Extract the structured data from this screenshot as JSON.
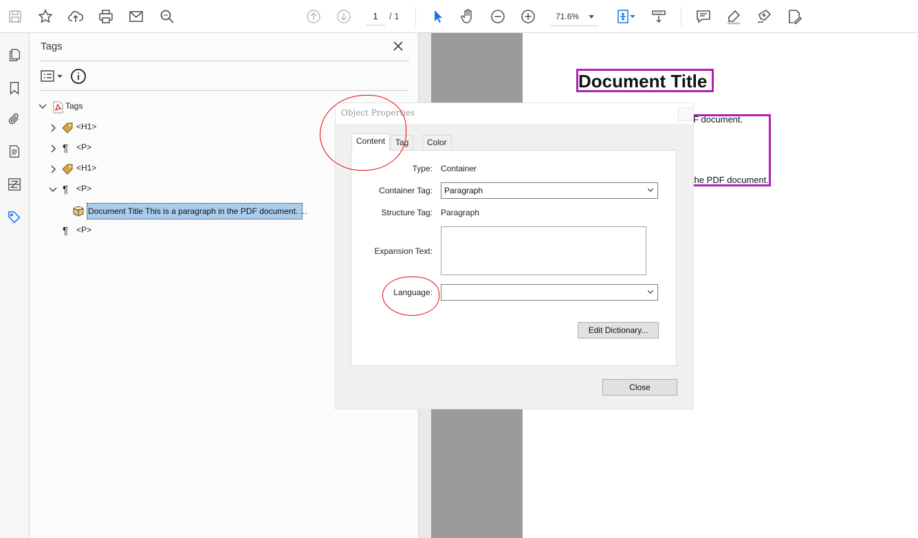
{
  "toolbar": {
    "page_current": "1",
    "page_total": "/ 1",
    "zoom": "71.6%",
    "icons": [
      "save-icon",
      "star-icon",
      "upload-cloud-icon",
      "print-icon",
      "email-icon",
      "search-icon",
      "page-up-icon",
      "page-down-icon",
      "select-arrow-icon",
      "hand-icon",
      "zoom-out-icon",
      "zoom-in-icon",
      "fit-page-icon",
      "scroll-mode-icon",
      "comment-icon",
      "highlight-icon",
      "sign-icon",
      "edit-icon"
    ]
  },
  "rail": {
    "icons": [
      "pages-icon",
      "bookmark-icon",
      "attachment-icon",
      "document-icon",
      "order-icon",
      "tags-icon"
    ]
  },
  "tags_panel": {
    "title": "Tags",
    "tree": [
      {
        "label": "Tags",
        "icon": "pdf-icon"
      },
      {
        "label": "<H1>",
        "icon": "tag-icon"
      },
      {
        "label": "<P>",
        "icon": "paragraph-icon"
      },
      {
        "label": "<H1>",
        "icon": "tag-icon"
      },
      {
        "label": "<P>",
        "icon": "paragraph-icon"
      },
      {
        "label": "Document Title This is a paragraph in the PDF document. ...",
        "icon": "container-icon"
      },
      {
        "label": "<P>",
        "icon": "paragraph-icon"
      }
    ]
  },
  "document": {
    "heading": "Document Title",
    "line1": "F document.",
    "line2": "the PDF document.",
    "accent": "#b11db8"
  },
  "dialog": {
    "title": "Object Properties",
    "tabs": [
      "Content",
      "Tag",
      "Color"
    ],
    "type_label": "Type:",
    "type_value": "Container",
    "container_tag_label": "Container Tag:",
    "container_tag_value": "Paragraph",
    "structure_tag_label": "Structure Tag:",
    "structure_tag_value": "Paragraph",
    "expansion_label": "Expansion Text:",
    "expansion_value": "",
    "language_label": "Language:",
    "language_value": "",
    "edit_dictionary": "Edit Dictionary...",
    "close": "Close"
  }
}
